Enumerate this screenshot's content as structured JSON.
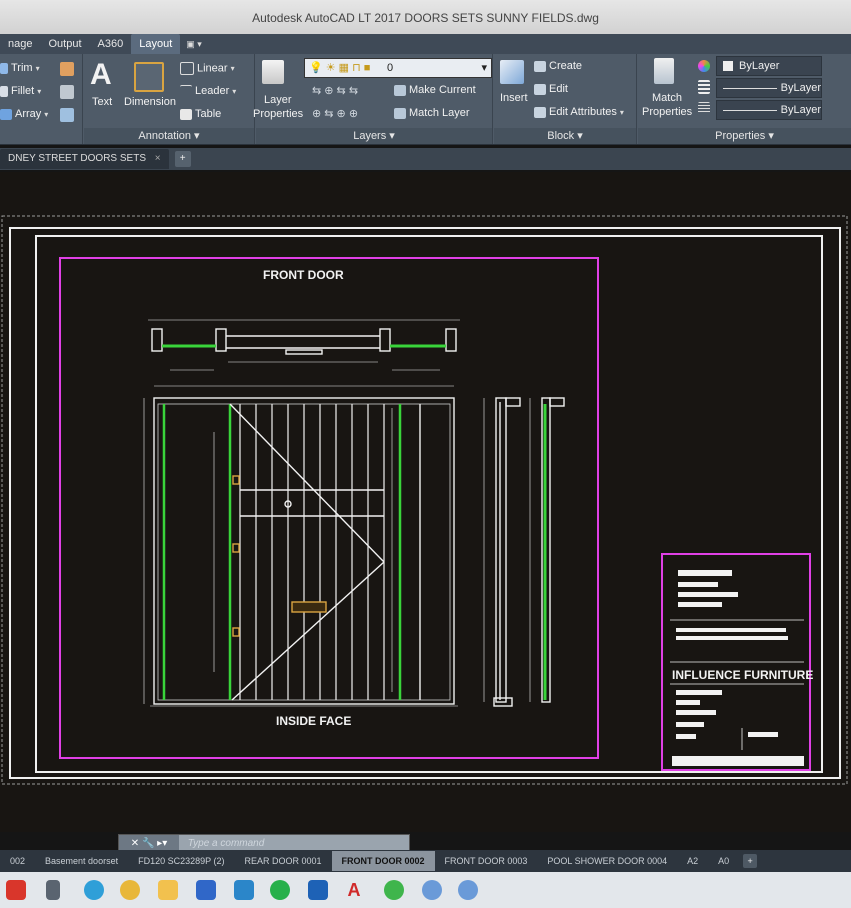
{
  "window": {
    "title": "Autodesk AutoCAD LT 2017    DOORS SETS SUNNY FIELDS.dwg"
  },
  "ribbon_tabs": [
    "nage",
    "Output",
    "A360",
    "Layout"
  ],
  "ribbon_tab_extra": "▣ ▾",
  "modify": {
    "trim": "Trim",
    "fillet": "Fillet",
    "array": "Array"
  },
  "annotation": {
    "text": "Text",
    "dimension": "Dimension",
    "linear": "Linear",
    "leader": "Leader",
    "table": "Table",
    "title": "Annotation ▾"
  },
  "layers": {
    "layer_properties_1": "Layer",
    "layer_properties_2": "Properties",
    "current_layer": "0",
    "make_current": "Make Current",
    "match_layer": "Match Layer",
    "title": "Layers ▾"
  },
  "block": {
    "insert": "Insert",
    "create": "Create",
    "edit": "Edit",
    "edit_attributes": "Edit Attributes",
    "title": "Block ▾"
  },
  "properties": {
    "match_1": "Match",
    "match_2": "Properties",
    "color": "ByLayer",
    "linetype": "ByLayer",
    "lineweight": "ByLayer",
    "title": "Properties ▾"
  },
  "doc_tab": {
    "label": "DNEY STREET DOORS SETS",
    "close": "×",
    "add": "+"
  },
  "drawing": {
    "title": "FRONT DOOR",
    "face_label": "INSIDE FACE",
    "company": "INFLUENCE FURNITURE"
  },
  "cmdline": {
    "placeholder": "Type a command",
    "tools": "✕ 🔧 ▸▾"
  },
  "layout_tabs": [
    "002",
    "Basement doorset",
    "FD120 SC23289P (2)",
    "REAR DOOR 0001",
    "FRONT DOOR 0002",
    "FRONT DOOR 0003",
    "POOL SHOWER DOOR 0004",
    "A2",
    "A0"
  ],
  "active_layout": "FRONT DOOR 0002",
  "colors": {
    "magenta": "#e040e6",
    "green": "#39d43a",
    "white": "#f2f2f2",
    "ribbon": "#4f5b68",
    "canvas": "#181512"
  }
}
